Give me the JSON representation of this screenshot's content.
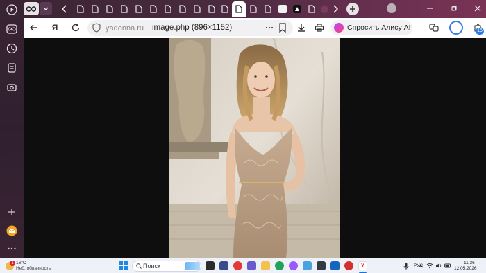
{
  "tab_strip": {
    "tab_count_note": "",
    "colors": {
      "strip_left": "#3a2433",
      "strip_right": "#7a3355",
      "active_tab": "#ffffff"
    }
  },
  "address_bar": {
    "domain": "yadonna.ru",
    "title": "image.php (896×1152)",
    "alice_button": "Спросить Алису AI",
    "extensions_badge": "15"
  },
  "left_rail": {
    "icons": [
      "play-icon",
      "infinity-icon",
      "history-icon",
      "collections-icon",
      "screenshot-icon",
      "add-icon",
      "mail-icon",
      "more-icon"
    ]
  },
  "content": {
    "image_alt": "image.php (896×1152)"
  },
  "taskbar": {
    "weather_temp": "16°C",
    "weather_desc": "Неб. облачность",
    "weather_alert": "1",
    "search_label": "Поиск",
    "lang": "РУС",
    "time": "11:36",
    "date": "12.05.2026"
  }
}
